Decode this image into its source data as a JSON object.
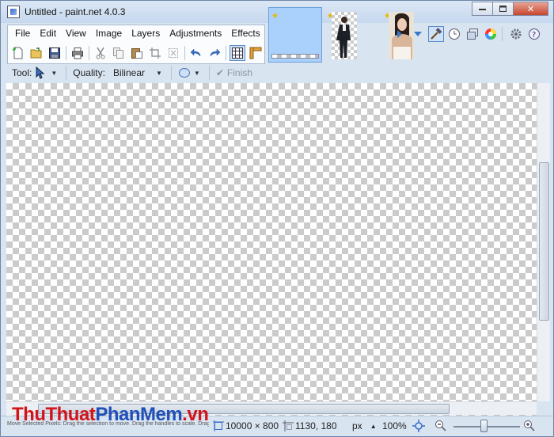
{
  "window": {
    "title": "Untitled - paint.net 4.0.3",
    "controls": [
      "minimize",
      "maximize",
      "close"
    ]
  },
  "menu": {
    "items": [
      "File",
      "Edit",
      "View",
      "Image",
      "Layers",
      "Adjustments",
      "Effects"
    ]
  },
  "toolbar": {
    "icons": [
      "new-file-icon",
      "open-icon",
      "save-icon",
      "print-icon",
      "cut-icon",
      "copy-icon",
      "paste-icon",
      "crop-icon",
      "deselect-icon",
      "undo-icon",
      "redo-icon",
      "grid-icon",
      "ruler-icon"
    ]
  },
  "image_tabs": [
    {
      "name": "untitled",
      "active": true
    },
    {
      "name": "man-photo",
      "active": false
    },
    {
      "name": "woman-photo",
      "active": false
    }
  ],
  "tool_options": {
    "tool_label": "Tool:",
    "quality_label": "Quality:",
    "quality_value": "Bilinear",
    "finish_label": "Finish"
  },
  "status": {
    "hint": "Move Selected Pixels: Drag the selection to move. Drag the handles to scale. Drag...",
    "watermark_red": "ThuThuat",
    "watermark_blue": "PhanMem",
    "watermark_suffix": ".vn",
    "image_size": "10000 × 800",
    "cursor_pos": "1130, 180",
    "unit": "px",
    "zoom": "100%"
  },
  "colors": {
    "accent": "#5a8bc8",
    "watermark_red": "#d3151b",
    "watermark_blue": "#1f4fb8"
  }
}
